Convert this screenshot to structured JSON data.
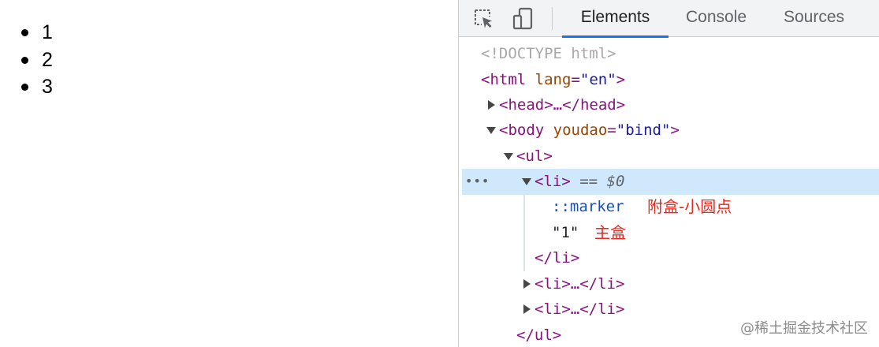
{
  "page": {
    "list_items": [
      "1",
      "2",
      "3"
    ]
  },
  "toolbar": {
    "inspect_icon": "select-element-icon",
    "device_icon": "device-toolbar-icon",
    "tabs": [
      {
        "label": "Elements",
        "active": true
      },
      {
        "label": "Console",
        "active": false
      },
      {
        "label": "Sources",
        "active": false
      }
    ],
    "accent_color": "#1a73e8"
  },
  "tree": {
    "doctype": "<!DOCTYPE html>",
    "html_open": "<html",
    "html_attr": "lang",
    "html_attr_val": "\"en\"",
    "head_collapsed": "<head>…</head>",
    "body_open": "<body",
    "body_attr": "youdao",
    "body_attr_val": "\"bind\"",
    "ul_open": "<ul>",
    "li_open": "<li>",
    "selected_marker": "== $0",
    "more_dots": "•••",
    "pseudo_marker": "::marker",
    "marker_note": "附盒-小圆点",
    "text_node": "\"1\"",
    "text_note": "主盒",
    "li_close": "</li>",
    "li_collapsed_1": "<li>…</li>",
    "li_collapsed_2": "<li>…</li>",
    "ul_close": "</ul>",
    "selection_color": "#cfe8fc",
    "note_color": "#e8271e"
  },
  "watermark": "@稀土掘金技术社区"
}
